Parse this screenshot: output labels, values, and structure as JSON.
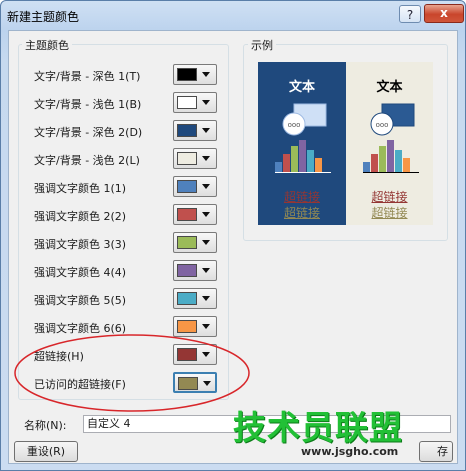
{
  "window": {
    "title": "新建主题颜色",
    "help_glyph": "?",
    "close_glyph": "x"
  },
  "theme_colors": {
    "group_label": "主题颜色",
    "items": [
      {
        "label": "文字/背景 - 深色 1(T)",
        "color": "#000000"
      },
      {
        "label": "文字/背景 - 浅色 1(B)",
        "color": "#ffffff"
      },
      {
        "label": "文字/背景 - 深色 2(D)",
        "color": "#1f497d"
      },
      {
        "label": "文字/背景 - 浅色 2(L)",
        "color": "#eeece1"
      },
      {
        "label": "强调文字颜色 1(1)",
        "color": "#4f81bd"
      },
      {
        "label": "强调文字颜色 2(2)",
        "color": "#c0504d"
      },
      {
        "label": "强调文字颜色 3(3)",
        "color": "#9bbb59"
      },
      {
        "label": "强调文字颜色 4(4)",
        "color": "#8064a2"
      },
      {
        "label": "强调文字颜色 5(5)",
        "color": "#4bacc6"
      },
      {
        "label": "强调文字颜色 6(6)",
        "color": "#f79646"
      },
      {
        "label": "超链接(H)",
        "color": "#943634"
      },
      {
        "label": "已访问的超链接(F)",
        "color": "#938953"
      }
    ]
  },
  "sample": {
    "group_label": "示例",
    "text_label": "文本",
    "hyperlink": "超链接",
    "visited_hyperlink": "超链接"
  },
  "name": {
    "label": "名称(N):",
    "value": "自定义 4"
  },
  "buttons": {
    "reset": "重设(R)",
    "save_partial": "存"
  },
  "watermark": {
    "main": "技术员联盟",
    "url": "www.jsgho.com"
  }
}
